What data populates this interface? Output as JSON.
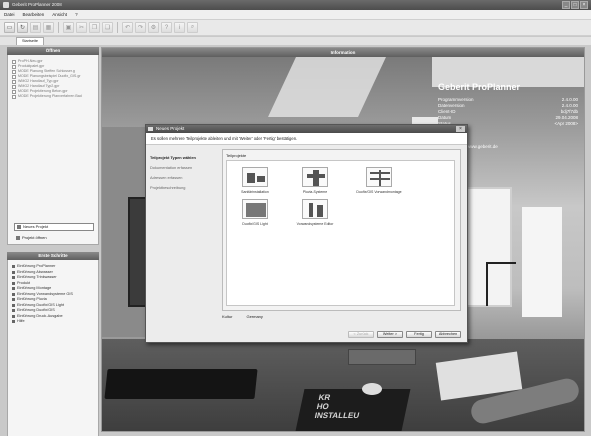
{
  "window": {
    "title": "Geberit ProPlanner 2008",
    "controls": [
      "_",
      "□",
      "×"
    ]
  },
  "menu": [
    "Datei",
    "Bearbeiten",
    "Ansicht",
    "?"
  ],
  "toolbar": {
    "icons": [
      "new-file-icon",
      "open-icon",
      "save-icon",
      "save-as-icon",
      "print-icon",
      "cut-icon",
      "copy-icon",
      "paste-icon",
      "undo-icon",
      "redo-icon",
      "settings-icon",
      "help-icon",
      "info-icon",
      "search-icon"
    ],
    "glyphs": [
      "▭",
      "↻",
      "▤",
      "▦",
      "▣",
      "✂",
      "❐",
      "❏",
      "↶",
      "↷",
      "⚙",
      "?",
      "i",
      "⌕"
    ]
  },
  "tab": {
    "label": "Startseite"
  },
  "open_panel": {
    "title": "Öffnen",
    "files": [
      "ProPH-Neu.gpr",
      "Produktpalet.gpr",
      "MODE Planung Steffen Schlosser.g",
      "MODE Planungsbeispiel Duofix_GIS.gr",
      "WMG2 Handlauf_Typ.gpr",
      "WMG2 Handlauf Typ2.gpr",
      "MODE Projektierung Beton.gpr",
      "MODE Projektierung Planverfahren Bad"
    ],
    "new_project": "Neues Projekt",
    "open_project": "Projekt öffnen"
  },
  "links_panel": {
    "title": "Erste Schritte",
    "links": [
      "Einführung ProPlanner",
      "Einführung Abwasser",
      "Einführung Trinkwasser",
      "Produkt",
      "Einführung Montage",
      "Einführung Vorwandsysteme GIS",
      "Einführung Pluvia",
      "Einführung Duofix/GIS Light",
      "Einführung Duofix/GIS",
      "Einführung Druck-Ausgabe",
      "Hilfe"
    ]
  },
  "info_panel": {
    "header": "Information",
    "title": "Geberit ProPlanner",
    "rows": [
      {
        "label": "Programmversion",
        "value": "2.4.0.00"
      },
      {
        "label": "Datenversion",
        "value": "2.4.0.00"
      },
      {
        "label": "Client-ID",
        "value": "bdj7f7db"
      },
      {
        "label": "Datum",
        "value": "29.04.2008"
      },
      {
        "label": "Status",
        "value": "<Apr 2008>"
      }
    ],
    "url": "www.geberit.de"
  },
  "scene": {
    "mat_text": "KR\nHO\nINSTALLEU"
  },
  "dialog": {
    "title": "Neues Projekt",
    "close": "×",
    "instruction": "Es sollen mehrere Teilprojekte ableiten und mit 'Weiter' oder 'Fertig' bestätigen.",
    "steps": [
      "Teilprojekt Typen wählen",
      "Dokumentation erfassen",
      "Adressen erfassen",
      "Projektbeschreibung"
    ],
    "templates_label": "Teilprojekte",
    "templates": [
      "Sanitärinstallation",
      "Pluvia-Systeme",
      "Duofix/GIS Vorwandmontage",
      "Duofix/GIS Light",
      "Vorwandsysteme Editor"
    ],
    "footer_left": "Kultur",
    "footer_right": "Germany",
    "buttons": {
      "back": "< Zurück",
      "next": "Weiter >",
      "finish": "Fertig",
      "cancel": "Abbrechen"
    }
  }
}
